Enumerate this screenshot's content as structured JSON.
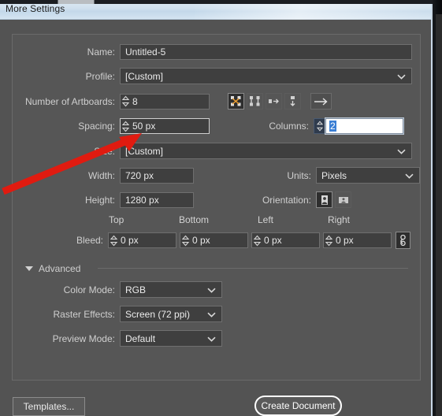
{
  "window": {
    "title": "More Settings"
  },
  "form": {
    "name": {
      "label": "Name:",
      "value": "Untitled-5"
    },
    "profile": {
      "label": "Profile:",
      "value": "[Custom]"
    },
    "artboards": {
      "label": "Number of Artboards:",
      "value": "8",
      "layout_icons": [
        {
          "name": "grid-by-row-icon",
          "selected": true
        },
        {
          "name": "grid-by-column-icon",
          "selected": false
        },
        {
          "name": "arrange-by-row-icon",
          "selected": false
        },
        {
          "name": "arrange-by-column-icon",
          "selected": false
        }
      ],
      "direction_icon": "right-to-left-arrow-icon"
    },
    "spacing": {
      "label": "Spacing:",
      "value": "50 px"
    },
    "columns": {
      "label": "Columns:",
      "value": "2"
    },
    "size": {
      "label": "Size:",
      "value": "[Custom]"
    },
    "width": {
      "label": "Width:",
      "value": "720 px"
    },
    "height": {
      "label": "Height:",
      "value": "1280 px"
    },
    "units": {
      "label": "Units:",
      "value": "Pixels"
    },
    "orientation": {
      "label": "Orientation:",
      "portrait_selected": true,
      "landscape_selected": false
    },
    "bleed": {
      "label": "Bleed:",
      "columns": [
        "Top",
        "Bottom",
        "Left",
        "Right"
      ],
      "values": [
        "0 px",
        "0 px",
        "0 px",
        "0 px"
      ],
      "link_icon": "chain-link-icon"
    }
  },
  "advanced": {
    "label": "Advanced",
    "expanded": true,
    "color_mode": {
      "label": "Color Mode:",
      "value": "RGB"
    },
    "raster_effects": {
      "label": "Raster Effects:",
      "value": "Screen (72 ppi)"
    },
    "preview_mode": {
      "label": "Preview Mode:",
      "value": "Default"
    }
  },
  "footer": {
    "templates_label": "Templates...",
    "create_label": "Create Document"
  },
  "colors": {
    "dialog_bg": "#535353",
    "panel_bg": "#565656",
    "field_bg": "#3f3f3f",
    "title_bg": "#cfe0ee",
    "annotation": "#e01b10",
    "selection_blue": "#3b7fd4"
  }
}
